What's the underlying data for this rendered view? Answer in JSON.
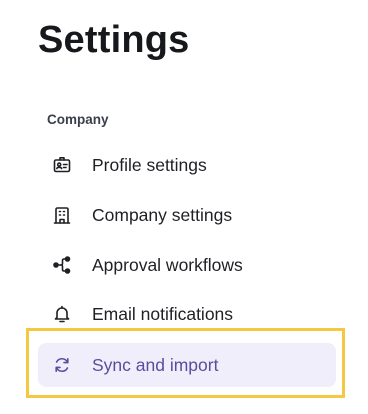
{
  "page": {
    "title": "Settings"
  },
  "sidebar": {
    "section_label": "Company",
    "items": [
      {
        "label": "Profile settings",
        "icon": "id-badge-icon",
        "active": false
      },
      {
        "label": "Company settings",
        "icon": "building-icon",
        "active": false
      },
      {
        "label": "Approval workflows",
        "icon": "workflow-branch-icon",
        "active": false
      },
      {
        "label": "Email notifications",
        "icon": "bell-icon",
        "active": false
      },
      {
        "label": "Sync and import",
        "icon": "sync-icon",
        "active": true
      }
    ]
  },
  "colors": {
    "active_background": "#f0eefb",
    "active_text": "#5a4d9c",
    "highlight_border": "#f5c842",
    "text": "#1f2024"
  }
}
